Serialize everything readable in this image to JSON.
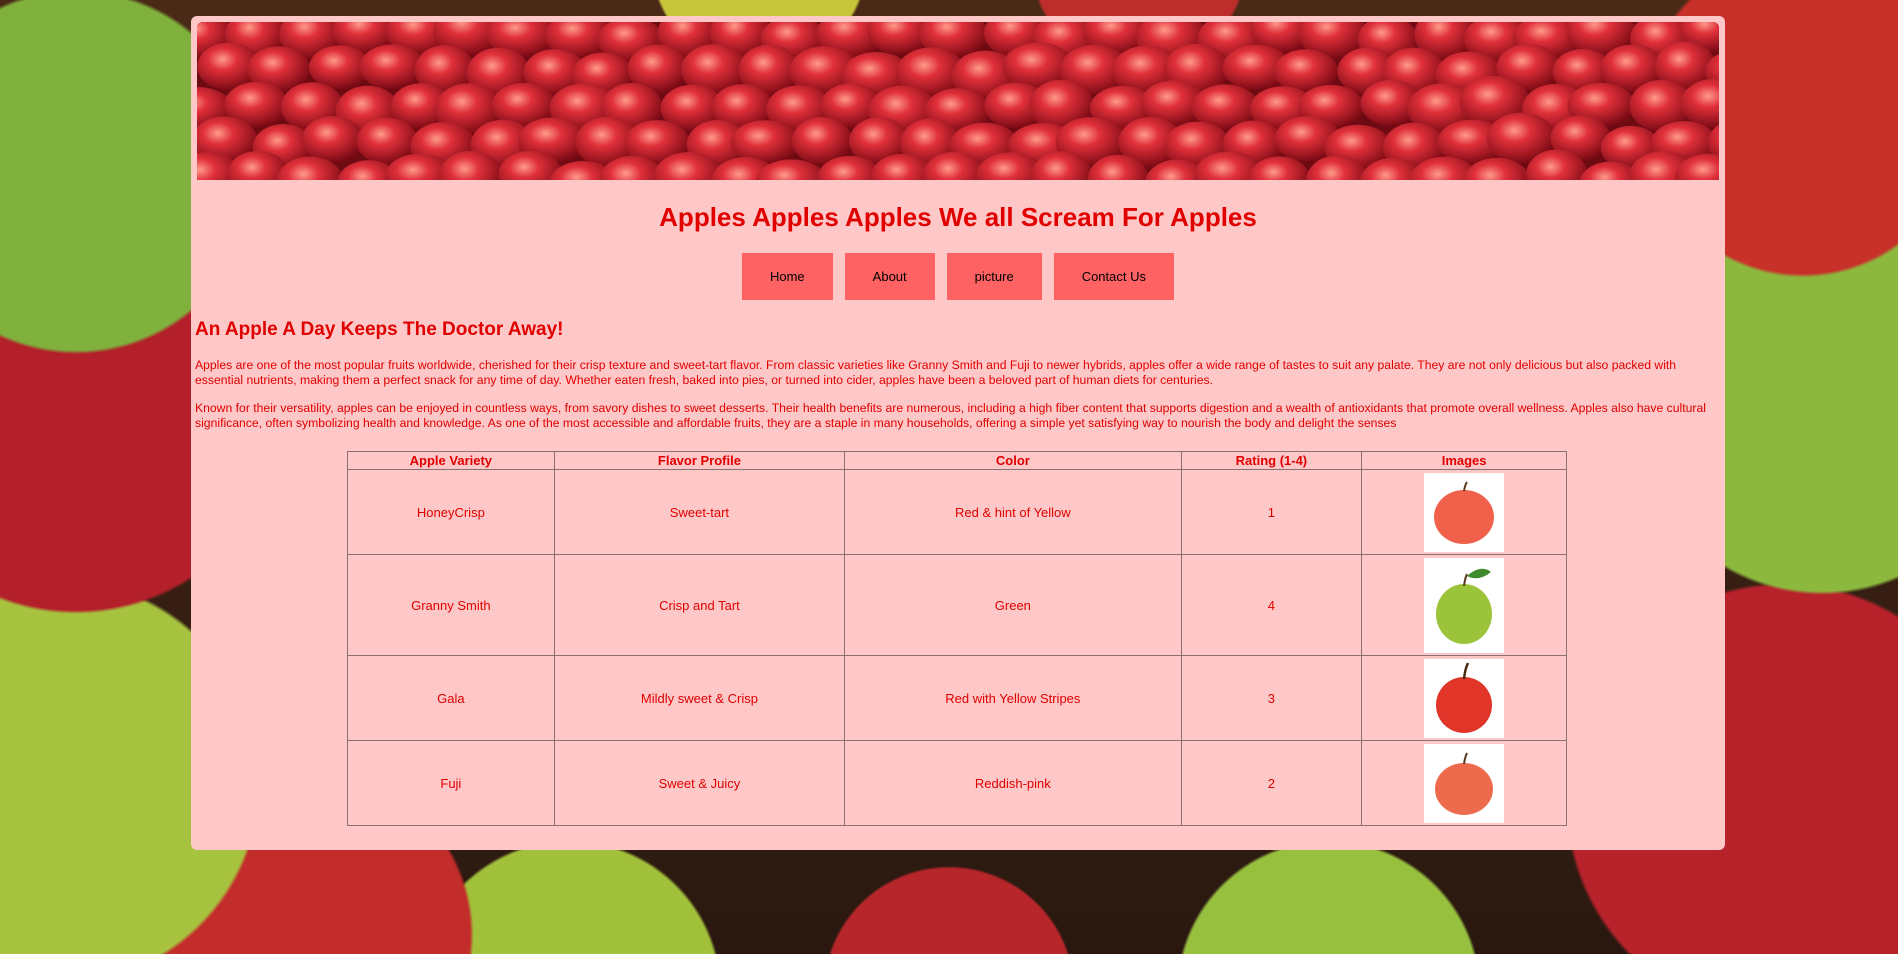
{
  "header": {
    "banner_alt": "apples banner",
    "title": "Apples Apples Apples We all Scream For Apples"
  },
  "nav": {
    "items": [
      {
        "label": "Home"
      },
      {
        "label": "About"
      },
      {
        "label": "picture"
      },
      {
        "label": "Contact Us"
      }
    ]
  },
  "main": {
    "heading": "An Apple A Day Keeps The Doctor Away!",
    "paragraph1": "Apples are one of the most popular fruits worldwide, cherished for their crisp texture and sweet-tart flavor. From classic varieties like Granny Smith and Fuji to newer hybrids, apples offer a wide range of tastes to suit any palate. They are not only delicious but also packed with essential nutrients, making them a perfect snack for any time of day. Whether eaten fresh, baked into pies, or turned into cider, apples have been a beloved part of human diets for centuries.",
    "paragraph2": "Known for their versatility, apples can be enjoyed in countless ways, from savory dishes to sweet desserts. Their health benefits are numerous, including a high fiber content that supports digestion and a wealth of antioxidants that promote overall wellness. Apples also have cultural significance, often symbolizing health and knowledge. As one of the most accessible and affordable fruits, they are a staple in many households, offering a simple yet satisfying way to nourish the body and delight the senses"
  },
  "table": {
    "headers": [
      "Apple Variety",
      "Flavor Profile",
      "Color",
      "Rating (1-4)",
      "Images"
    ],
    "rows": [
      {
        "variety": "HoneyCrisp",
        "flavor": "Sweet-tart",
        "color": "Red & hint of Yellow",
        "rating": "1",
        "image_icon": "honeycrisp-apple-image",
        "apple_color": "#f0604a"
      },
      {
        "variety": "Granny Smith",
        "flavor": "Crisp and Tart",
        "color": "Green",
        "rating": "4",
        "image_icon": "granny-smith-apple-image",
        "apple_color": "#9cc43a"
      },
      {
        "variety": "Gala",
        "flavor": "Mildly sweet & Crisp",
        "color": "Red with Yellow Stripes",
        "rating": "3",
        "image_icon": "gala-apple-image",
        "apple_color": "#e2352a"
      },
      {
        "variety": "Fuji",
        "flavor": "Sweet & Juicy",
        "color": "Reddish-pink",
        "rating": "2",
        "image_icon": "fuji-apple-image",
        "apple_color": "#ee6a4c"
      }
    ]
  },
  "colors": {
    "panel_bg": "#ffc8c8",
    "accent_text": "#e00000",
    "nav_button_bg": "#ff6262"
  }
}
